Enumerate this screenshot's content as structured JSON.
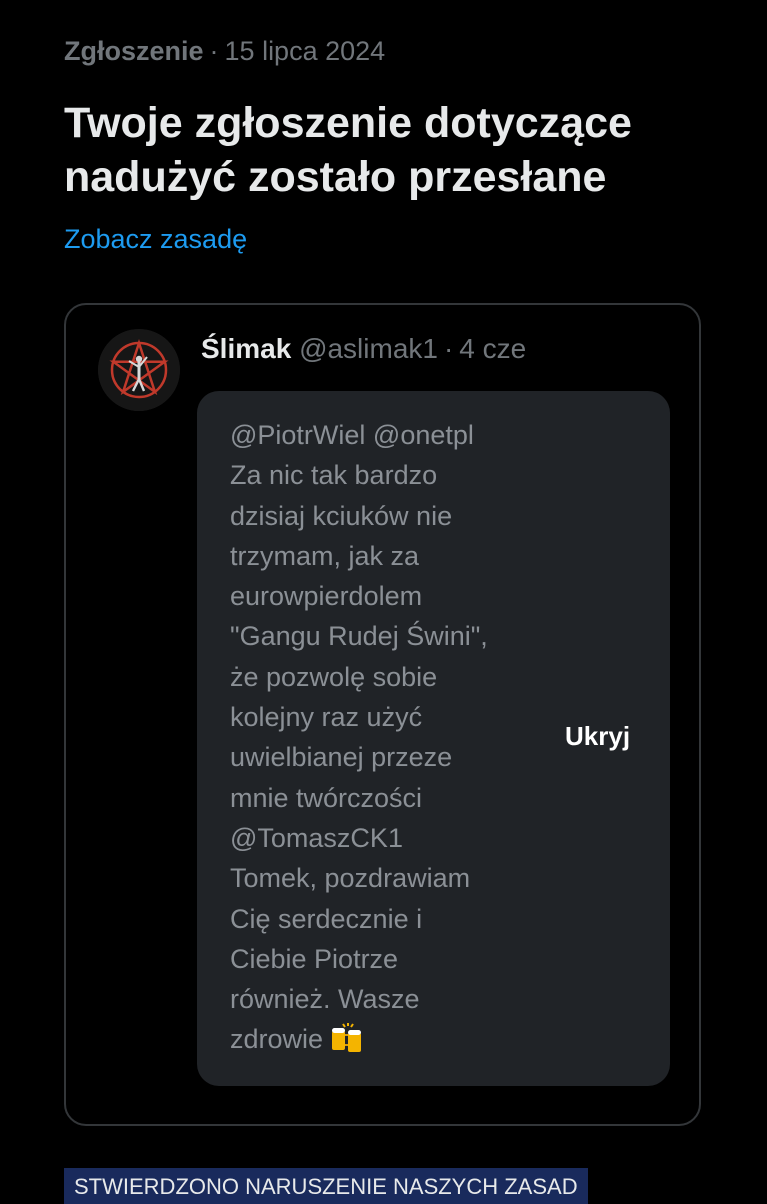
{
  "report": {
    "kind": "Zgłoszenie",
    "separator": "·",
    "date": "15 lipca 2024",
    "title": "Twoje zgłoszenie dotyczące nadużyć zostało przesłane",
    "policy_link": "Zobacz zasadę"
  },
  "post": {
    "avatar_icon": "pentagram-avatar-icon",
    "author_name": "Ślimak",
    "handle": "@aslimak1",
    "separator": "·",
    "time": "4 cze",
    "text": "@PiotrWiel @onetpl\nZa nic tak bardzo\ndzisiaj kciuków nie\ntrzymam, jak za\neurowpierdolem\n\"Gangu Rudej Świni\",\nże pozwolę sobie\nkolejny raz użyć\nuwielbianej przeze\nmnie twórczości\n@TomaszCK1\nTomek, pozdrawiam\nCię serdecznie i\nCiebie Piotrze\nrównież.  Wasze\nzdrowie",
    "emoji_icon": "clinking-beer-mugs-icon",
    "hide_label": "Ukryj"
  },
  "status": {
    "label": "STWIERDZONO NARUSZENIE NASZYCH ZASAD"
  },
  "colors": {
    "background": "#000000",
    "link": "#1d9bf0",
    "muted": "#71767b",
    "bubble": "#202327",
    "badge": "#192a5c"
  }
}
